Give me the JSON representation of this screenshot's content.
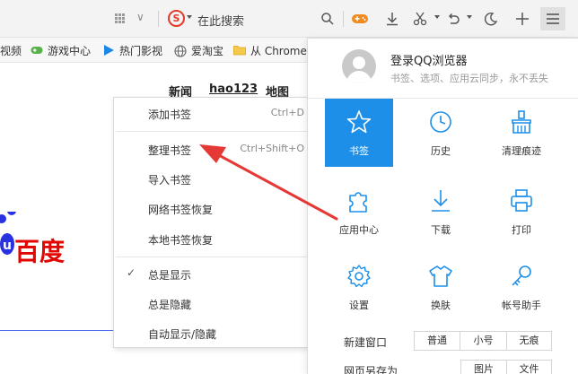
{
  "toolbar": {
    "search_placeholder": "在此搜索",
    "icons": [
      "grid-icon",
      "chevron-down-icon",
      "sogou-engine-icon",
      "search-icon",
      "game-controller-icon",
      "download-icon",
      "scissors-icon",
      "undo-icon",
      "moon-icon",
      "plus-icon",
      "menu-icon"
    ]
  },
  "bookmarks_bar": {
    "items": [
      {
        "label": "视频"
      },
      {
        "label": "游戏中心",
        "icon": "gamepad-icon"
      },
      {
        "label": "热门影视",
        "icon": "play-icon"
      },
      {
        "label": "爱淘宝",
        "icon": "globe-icon"
      },
      {
        "label": "从 Chrome",
        "icon": "folder-icon"
      }
    ]
  },
  "page": {
    "nav_links": [
      "新闻",
      "hao123",
      "地图"
    ],
    "logo_text": "百度"
  },
  "bookmark_menu": {
    "items": [
      {
        "label": "添加书签",
        "shortcut": "Ctrl+D"
      },
      {
        "label": "整理书签",
        "shortcut": "Ctrl+Shift+O"
      },
      {
        "label": "导入书签",
        "shortcut": ""
      },
      {
        "label": "网络书签恢复",
        "shortcut": ""
      },
      {
        "label": "本地书签恢复",
        "shortcut": ""
      },
      {
        "label": "总是显示",
        "shortcut": "",
        "checked": true
      },
      {
        "label": "总是隐藏",
        "shortcut": ""
      },
      {
        "label": "自动显示/隐藏",
        "shortcut": ""
      }
    ]
  },
  "panel": {
    "login_title": "登录QQ浏览器",
    "login_subtitle": "书签、选项、应用云同步，永不丢失",
    "tiles": [
      {
        "label": "书签",
        "icon": "star-icon",
        "active": true
      },
      {
        "label": "历史",
        "icon": "clock-icon"
      },
      {
        "label": "清理痕迹",
        "icon": "broom-icon"
      },
      {
        "label": "应用中心",
        "icon": "puzzle-icon"
      },
      {
        "label": "下载",
        "icon": "download-icon"
      },
      {
        "label": "打印",
        "icon": "printer-icon"
      },
      {
        "label": "设置",
        "icon": "gear-icon"
      },
      {
        "label": "换肤",
        "icon": "shirt-icon"
      },
      {
        "label": "帐号助手",
        "icon": "key-icon"
      }
    ],
    "new_window_label": "新建窗口",
    "new_window_options": [
      "普通",
      "小号",
      "无痕"
    ],
    "save_as_label": "网页另存为",
    "save_as_options": [
      "图片",
      "文件"
    ]
  },
  "colors": {
    "accent_blue": "#1d8fe8",
    "arrow_red": "#e53935",
    "baidu_red": "#e10602",
    "baidu_blue": "#2932e1"
  }
}
